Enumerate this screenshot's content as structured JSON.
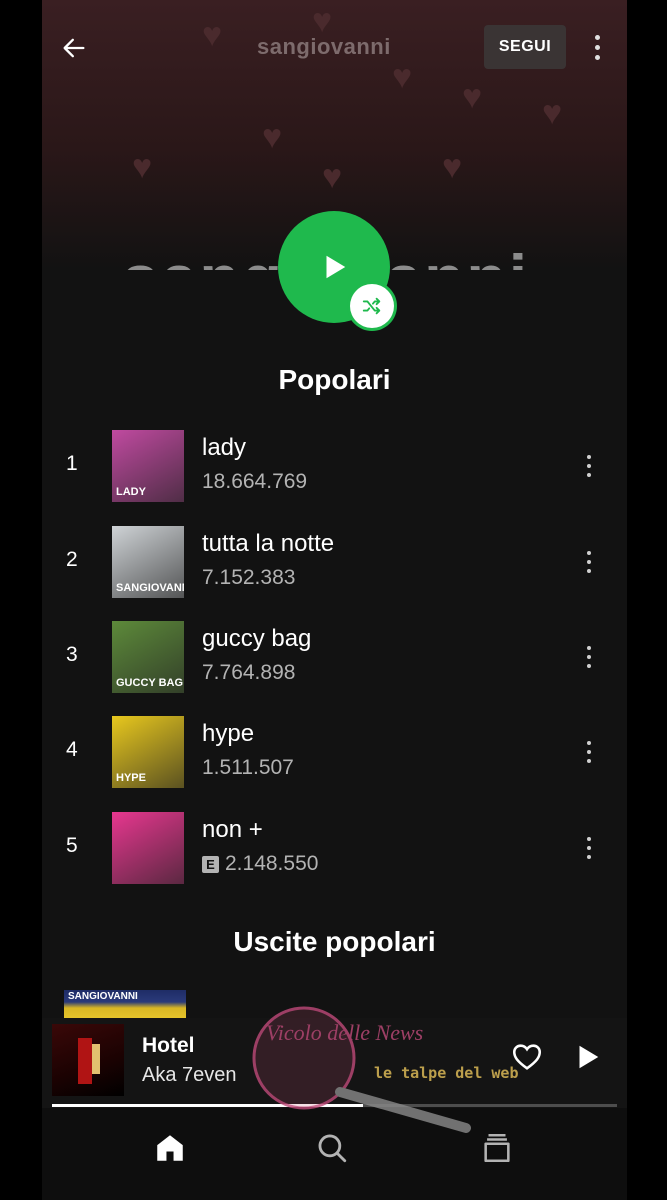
{
  "header": {
    "artist_name": "sangiovanni",
    "follow_label": "SEGUI",
    "big_artist_name": "sangiovanni"
  },
  "sections": {
    "popular_title": "Popolari",
    "releases_title": "Uscite popolari"
  },
  "tracks": [
    {
      "rank": "1",
      "title": "lady",
      "plays": "18.664.769",
      "explicit": false,
      "cover_color": "#c04aa0",
      "cover_text": "LADY"
    },
    {
      "rank": "2",
      "title": "tutta la notte",
      "plays": "7.152.383",
      "explicit": false,
      "cover_color": "#cfd3d6",
      "cover_text": "SANGIOVANNI"
    },
    {
      "rank": "3",
      "title": "guccy bag",
      "plays": "7.764.898",
      "explicit": false,
      "cover_color": "#5d8a3a",
      "cover_text": "GUCCY BAG"
    },
    {
      "rank": "4",
      "title": "hype",
      "plays": "1.511.507",
      "explicit": false,
      "cover_color": "#e8c81e",
      "cover_text": "HYPE"
    },
    {
      "rank": "5",
      "title": "non +",
      "plays": "2.148.550",
      "explicit": true,
      "explicit_label": "E",
      "cover_color": "#e7378f",
      "cover_text": ""
    }
  ],
  "release_peek_label": "SANGIOVANNI",
  "now_playing": {
    "title": "Hotel",
    "artist": "Aka 7even",
    "progress": 0.55
  },
  "watermark": {
    "logo_text": "Vicolo delle News",
    "tagline": "le talpe del web"
  },
  "colors": {
    "accent": "#1fb94d",
    "background": "#121212",
    "secondary_text": "#b3b3b3"
  },
  "icons": {
    "back": "arrow-left-icon",
    "more": "more-vertical-icon",
    "play": "play-icon",
    "shuffle": "shuffle-icon",
    "heart": "heart-icon",
    "home": "home-icon",
    "search": "search-icon",
    "library": "library-icon"
  }
}
